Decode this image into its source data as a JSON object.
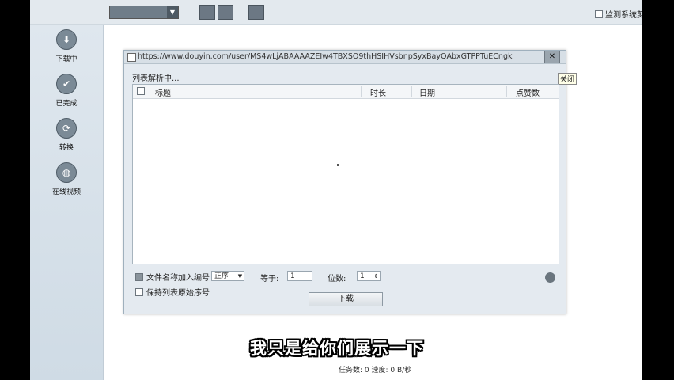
{
  "toolbar": {
    "dropdown_value": "",
    "monitor_label": "监测系统剪"
  },
  "sidebar": {
    "items": [
      {
        "label": "下载中",
        "icon": "download-icon"
      },
      {
        "label": "已完成",
        "icon": "check-icon"
      },
      {
        "label": "转换",
        "icon": "convert-icon"
      },
      {
        "label": "在线视频",
        "icon": "globe-icon"
      }
    ]
  },
  "dialog": {
    "url": "https://www.douyin.com/user/MS4wLjABAAAAZEIw4TBXSO9thHSIHVsbnpSyxBayQAbxGTPPTuECngk",
    "close_tooltip": "关闭",
    "parsing_text": "列表解析中...",
    "columns": {
      "title": "标题",
      "duration": "时长",
      "date": "日期",
      "likes": "点赞数"
    },
    "options": {
      "filename_number_label": "文件名称加入编号",
      "position_value": "正序",
      "equals_label": "等于:",
      "equals_value": "1",
      "digits_label": "位数:",
      "digits_value": "1",
      "keep_order_label": "保持列表原始序号"
    },
    "download_button": "下载"
  },
  "status_bar": {
    "text": "任务数: 0  速度: 0 B/秒"
  },
  "subtitle": "我只是给你们展示一下"
}
